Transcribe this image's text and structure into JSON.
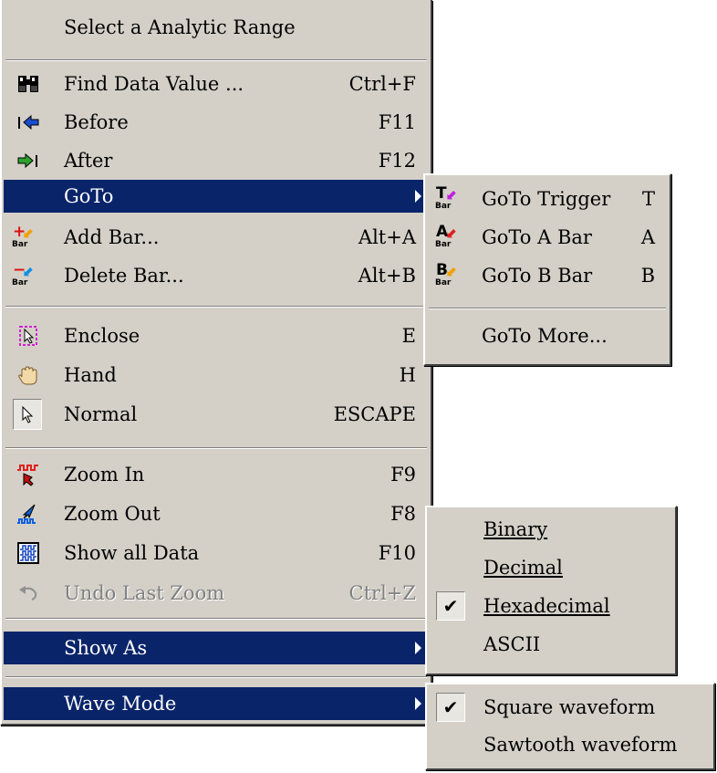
{
  "main_menu": {
    "header": "Select a Analytic Range",
    "items": [
      {
        "label": "Find Data Value ...",
        "shortcut": "Ctrl+F",
        "icon": "binoculars-icon"
      },
      {
        "label": "Before",
        "shortcut": "F11",
        "icon": "jump-before-icon"
      },
      {
        "label": "After",
        "shortcut": "F12",
        "icon": "jump-after-icon"
      },
      {
        "label": "GoTo",
        "shortcut": "",
        "icon": ""
      },
      {
        "label": "Add Bar...",
        "shortcut": "Alt+A",
        "icon": "add-bar-icon"
      },
      {
        "label": "Delete Bar...",
        "shortcut": "Alt+B",
        "icon": "delete-bar-icon"
      },
      {
        "label": "Enclose",
        "shortcut": "E",
        "icon": "enclose-icon"
      },
      {
        "label": "Hand",
        "shortcut": "H",
        "icon": "hand-icon"
      },
      {
        "label": "Normal",
        "shortcut": "ESCAPE",
        "icon": "pointer-icon"
      },
      {
        "label": "Zoom In",
        "shortcut": "F9",
        "icon": "zoom-in-icon"
      },
      {
        "label": "Zoom Out",
        "shortcut": "F8",
        "icon": "zoom-out-icon"
      },
      {
        "label": "Show all Data",
        "shortcut": "F10",
        "icon": "show-all-data-icon"
      },
      {
        "label": "Undo Last Zoom",
        "shortcut": "Ctrl+Z",
        "icon": "undo-icon"
      },
      {
        "label": "Show As",
        "shortcut": "",
        "icon": ""
      },
      {
        "label": "Wave Mode",
        "shortcut": "",
        "icon": ""
      }
    ]
  },
  "goto_submenu": {
    "items": [
      {
        "label": "GoTo Trigger",
        "shortcut": "T",
        "icon_letter": "T",
        "icon_sub": "Bar"
      },
      {
        "label": "GoTo A Bar",
        "shortcut": "A",
        "icon_letter": "A",
        "icon_sub": "Bar"
      },
      {
        "label": "GoTo B Bar",
        "shortcut": "B",
        "icon_letter": "B",
        "icon_sub": "Bar"
      },
      {
        "label": "GoTo More...",
        "shortcut": ""
      }
    ]
  },
  "show_as_submenu": {
    "items": [
      {
        "label": "Binary",
        "checked": false
      },
      {
        "label": "Decimal",
        "checked": false
      },
      {
        "label": "Hexadecimal",
        "checked": true
      },
      {
        "label": "ASCII",
        "checked": false
      }
    ]
  },
  "wave_mode_submenu": {
    "items": [
      {
        "label": "Square waveform",
        "checked": true
      },
      {
        "label": "Sawtooth waveform",
        "checked": false
      }
    ]
  },
  "colors": {
    "highlight": "#0a246a",
    "menu_bg": "#d4d0c8"
  }
}
